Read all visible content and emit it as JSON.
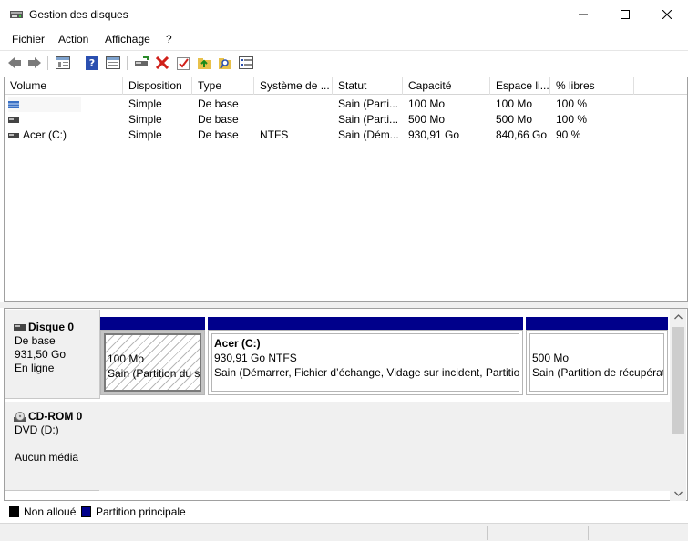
{
  "window": {
    "title": "Gestion des disques"
  },
  "menu": {
    "items": [
      "Fichier",
      "Action",
      "Affichage",
      "?"
    ]
  },
  "toolbar": {
    "icons": [
      "back-arrow-icon",
      "forward-arrow-icon",
      "console-tree-icon",
      "help-icon",
      "properties-icon",
      "connect-disk-icon",
      "delete-icon",
      "check-icon",
      "folder-up-icon",
      "search-folder-icon",
      "list-view-icon"
    ]
  },
  "volume_list": {
    "columns": [
      "Volume",
      "Disposition",
      "Type",
      "Système de ...",
      "Statut",
      "Capacité",
      "Espace li...",
      "% libres"
    ],
    "rows": [
      {
        "volume": "",
        "icon": "striped-volume-icon",
        "disposition": "Simple",
        "type": "De base",
        "fs": "",
        "status": "Sain (Parti...",
        "capacity": "100 Mo",
        "free": "100 Mo",
        "pct": "100 %"
      },
      {
        "volume": "",
        "icon": "volume-icon",
        "disposition": "Simple",
        "type": "De base",
        "fs": "",
        "status": "Sain (Parti...",
        "capacity": "500 Mo",
        "free": "500 Mo",
        "pct": "100 %"
      },
      {
        "volume": "Acer (C:)",
        "icon": "volume-icon",
        "disposition": "Simple",
        "type": "De base",
        "fs": "NTFS",
        "status": "Sain (Dém...",
        "capacity": "930,91 Go",
        "free": "840,66 Go",
        "pct": "90 %"
      }
    ]
  },
  "disks": [
    {
      "name": "Disque 0",
      "type": "De base",
      "size": "931,50 Go",
      "state": "En ligne",
      "partitions": [
        {
          "title": "",
          "size": "100 Mo",
          "status": "Sain (Partition du système EFI)"
        },
        {
          "title": "Acer  (C:)",
          "size": "930,91 Go NTFS",
          "status": "Sain (Démarrer, Fichier d’échange, Vidage sur incident, Partition de données de base)"
        },
        {
          "title": "",
          "size": "500 Mo",
          "status": "Sain (Partition de récupération)"
        }
      ]
    },
    {
      "name": "CD-ROM 0",
      "type": "DVD (D:)",
      "media": "Aucun média"
    }
  ],
  "legend": {
    "items": [
      {
        "label": "Non alloué",
        "color": "#000000"
      },
      {
        "label": "Partition principale",
        "color": "#00008b"
      }
    ]
  }
}
